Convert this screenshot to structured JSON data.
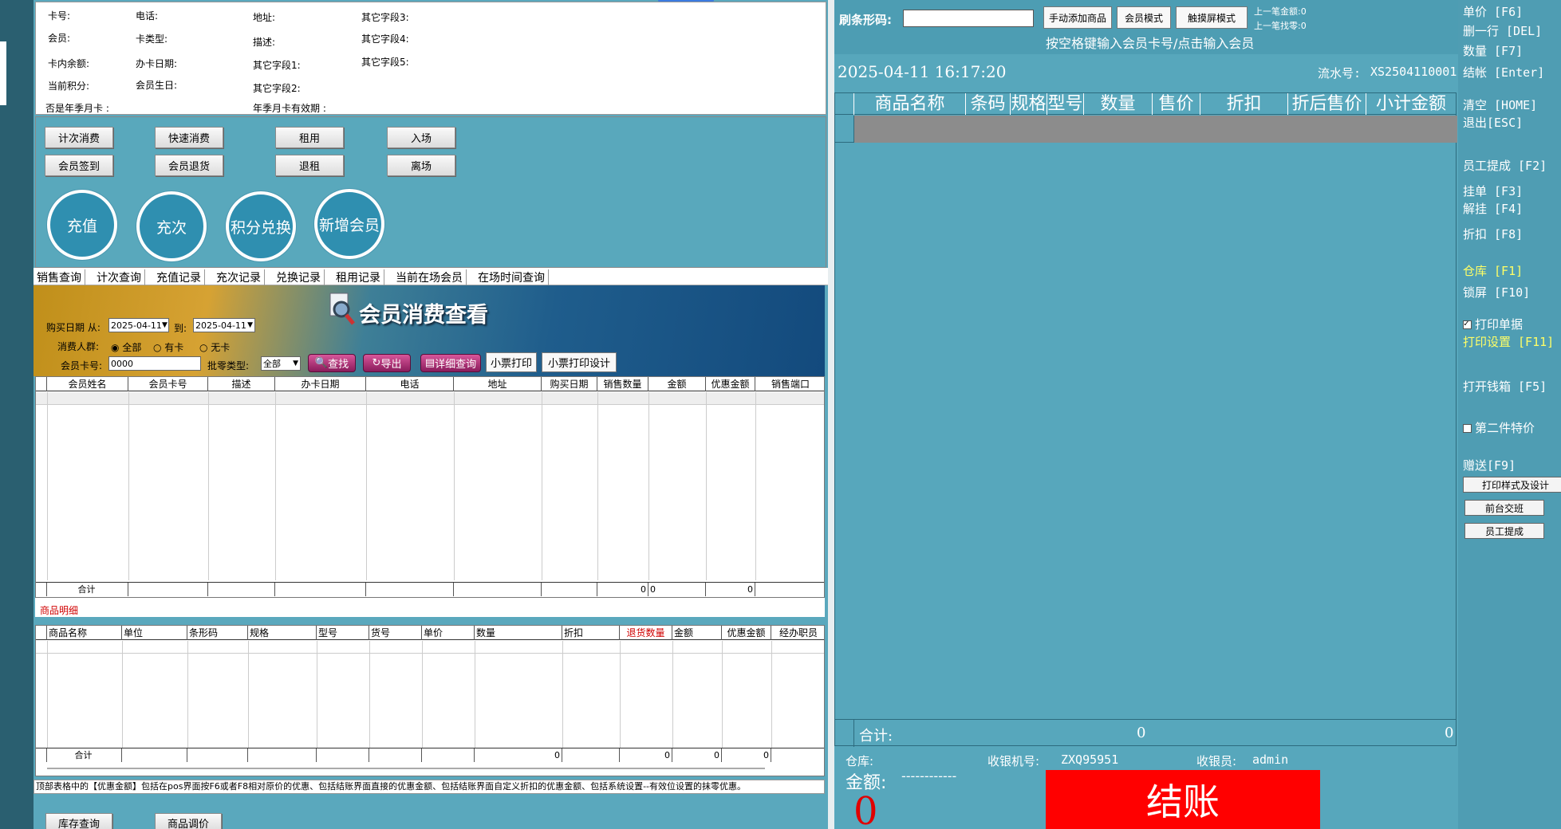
{
  "info_fields": {
    "card_no": "卡号:",
    "phone": "电话:",
    "address": "地址:",
    "other3": "其它字段3:",
    "member": "会员:",
    "card_type": "卡类型:",
    "desc": "描述:",
    "other4": "其它字段4:",
    "balance": "卡内余额:",
    "issue_date": "办卡日期:",
    "other1": "其它字段1:",
    "other5": "其它字段5:",
    "points": "当前积分:",
    "birthday": "会员生日:",
    "other2": "其它字段2:",
    "annual_card": "否是年季月卡 :",
    "annual_valid": "年季月卡有效期 :"
  },
  "ops_buttons": {
    "count_consume": "计次消费",
    "quick_consume": "快速消费",
    "rent": "租用",
    "enter": "入场",
    "checkin": "会员签到",
    "return": "会员退货",
    "return_rent": "退租",
    "leave": "离场"
  },
  "circle_buttons": [
    "充值",
    "充次",
    "积分兑换",
    "新增会员"
  ],
  "tabs": [
    "销售查询",
    "计次查询",
    "充值记录",
    "充次记录",
    "兑换记录",
    "租用记录",
    "当前在场会员",
    "在场时间查询"
  ],
  "query": {
    "title": "会员消费查看",
    "date_label": "购买日期 从:",
    "date_from": "2025-04-11",
    "to_label": "到:",
    "date_to": "2025-04-11",
    "crowd_label": "消费人群:",
    "crowd_options": [
      "全部",
      "有卡",
      "无卡"
    ],
    "card_label": "会员卡号:",
    "card_value": "0000",
    "wholesale_label": "批零类型:",
    "wholesale_value": "全部",
    "btn_search": "查找",
    "btn_export": "导出",
    "btn_detail": "详细查询",
    "btn_print": "小票打印",
    "btn_print_design": "小票打印设计"
  },
  "grid1": {
    "headers": [
      "会员姓名",
      "会员卡号",
      "描述",
      "办卡日期",
      "电话",
      "地址",
      "购买日期",
      "销售数量",
      "金额",
      "优惠金额",
      "销售端口"
    ],
    "sum_label": "合计",
    "sum_qty": "0",
    "sum_amount": "0",
    "sum_discount": "0"
  },
  "grid2": {
    "caption": "商品明细",
    "headers": [
      "商品名称",
      "单位",
      "条形码",
      "规格",
      "型号",
      "货号",
      "单价",
      "数量",
      "折扣",
      "退货数量",
      "金额",
      "优惠金额",
      "经办职员"
    ],
    "sum_label": "合计",
    "sum_qty": "0",
    "sum_return": "0",
    "sum_amount": "0",
    "sum_discount": "0"
  },
  "note": "顶部表格中的【优惠金额】包括在pos界面按F6或者F8相对原价的优惠、包括结账界面直接的优惠金额、包括结账界面自定义折扣的优惠金额、包括系统设置--有效位设置的抹零优惠。",
  "bottom_buttons": [
    "库存查询",
    "商品调价"
  ],
  "pos": {
    "barcode_label": "刷条形码:",
    "barcode_value": "",
    "btn_manual_add": "手动添加商品",
    "btn_member_mode": "会员模式",
    "btn_touch_mode": "触摸屏模式",
    "last_amount": "上一笔金额:0",
    "last_change": "上一笔找零:0",
    "hint": "按空格键输入会员卡号/点击输入会员",
    "datetime": "2025-04-11 16:17:20",
    "serial_label": "流水号:",
    "serial": "XS2504110001",
    "cart_headers": [
      "商品名称",
      "条码",
      "规格",
      "型号",
      "数量",
      "售价",
      "折扣",
      "折后售价",
      "小计金额"
    ],
    "total_label": "合计:",
    "total_qty": "0",
    "total_amount": "0",
    "warehouse_label": "仓库:",
    "register_label": "收银机号:",
    "register_value": "ZXQ95951",
    "cashier_label": "收银员:",
    "cashier_value": "admin",
    "amount_label": "金额:",
    "amount_dashes": "------------",
    "amount_value": "0",
    "checkout": "结账"
  },
  "sidebar": {
    "unit_price": "单价 [F6]",
    "delete_row": "删一行 [DEL]",
    "quantity": "数量 [F7]",
    "checkout": "结帐 [Enter]",
    "clear": "清空 [HOME]",
    "exit": "退出[ESC]",
    "staff_commission": "员工提成 [F2]",
    "hang": "挂单 [F3]",
    "unhang": "解挂 [F4]",
    "discount": "折扣 [F8]",
    "warehouse": "仓库 [F1]",
    "lock": "锁屏 [F10]",
    "print_receipt": "打印单据",
    "print_settings": "打印设置 [F11]",
    "open_drawer": "打开钱箱 [F5]",
    "second_special": "第二件特价",
    "gift": "赠送[F9]",
    "btn_print_style": "打印样式及设计",
    "btn_shift": "前台交班",
    "btn_staff": "员工提成"
  },
  "colors": {
    "panel": "#5aa8bd",
    "checkout_red": "#ff0000",
    "highlight_yellow": "#ffff66"
  }
}
